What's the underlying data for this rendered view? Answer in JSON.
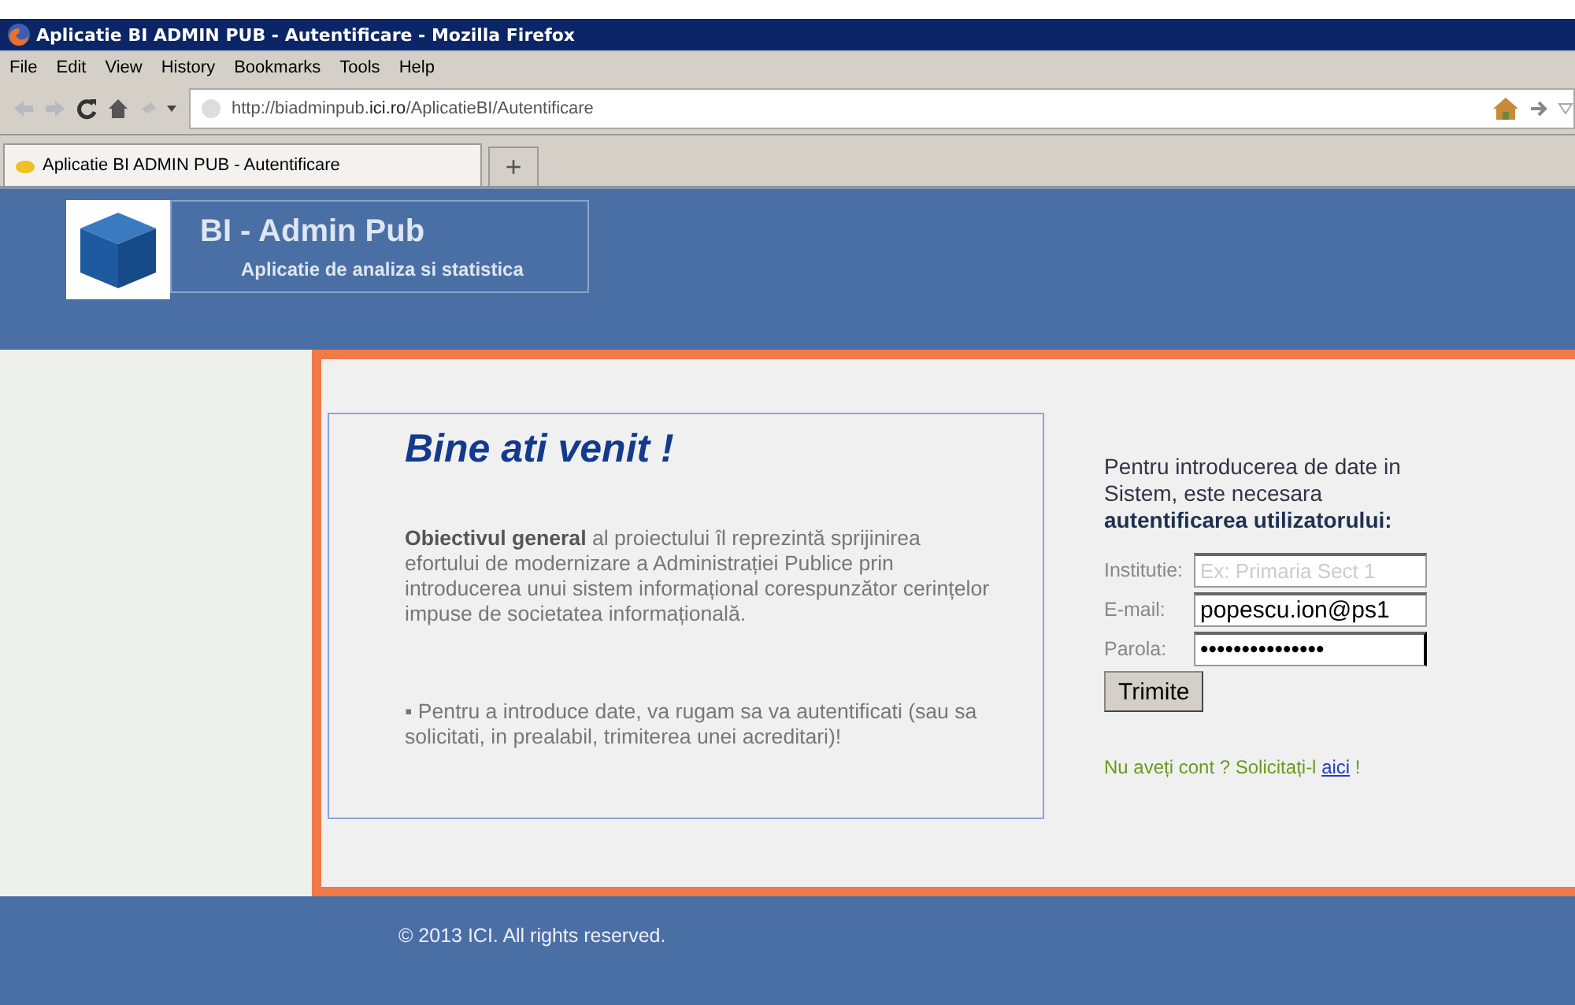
{
  "window": {
    "title": "Aplicatie BI ADMIN PUB - Autentificare - Mozilla Firefox"
  },
  "menu": [
    "File",
    "Edit",
    "View",
    "History",
    "Bookmarks",
    "Tools",
    "Help"
  ],
  "address_bar": {
    "value": "http://biadminpub.**ici.ro**/AplicatieBI/Autentificare"
  },
  "tabs": [
    {
      "label": "Aplicatie BI ADMIN PUB - Autentificare",
      "selected": true
    }
  ],
  "new_tab": "+",
  "header": {
    "title": "BI - Admin Pub",
    "subtitle": "Aplicatie de analiza si statistica"
  },
  "welcome": {
    "heading": "Bine ati venit !",
    "paragraphs": [
      "**Obiectivul general** al proiectului îl reprezintă sprijinirea efortului de modernizare a Administrației Publice prin introducerea unui sistem informațional corespunzător cerințelor impuse de societatea informațională.",
      "▪ Pentru a introduce date, va rugam sa va autentificati (sau sa solicitati, in prealabil, trimiterea unei acreditari)!"
    ]
  },
  "login": {
    "intro": "Pentru introducerea de date in Sistem, este necesara **autentificarea utilizatorului:**",
    "fields": [
      {
        "label": "Institutie:",
        "placeholder": "Ex: Primaria Sect 1"
      },
      {
        "label": "E-mail:",
        "value": "popescu.ion@ps1"
      },
      {
        "label": "Parola:",
        "value": "•••••••••••••••",
        "focused": true
      }
    ],
    "submit": "Trimite",
    "signup_text": "Nu aveți cont ? Solicitați-l ",
    "signup_link": "aici",
    "signup_end": " !"
  },
  "footer": "© 2013 ICI. All rights reserved."
}
